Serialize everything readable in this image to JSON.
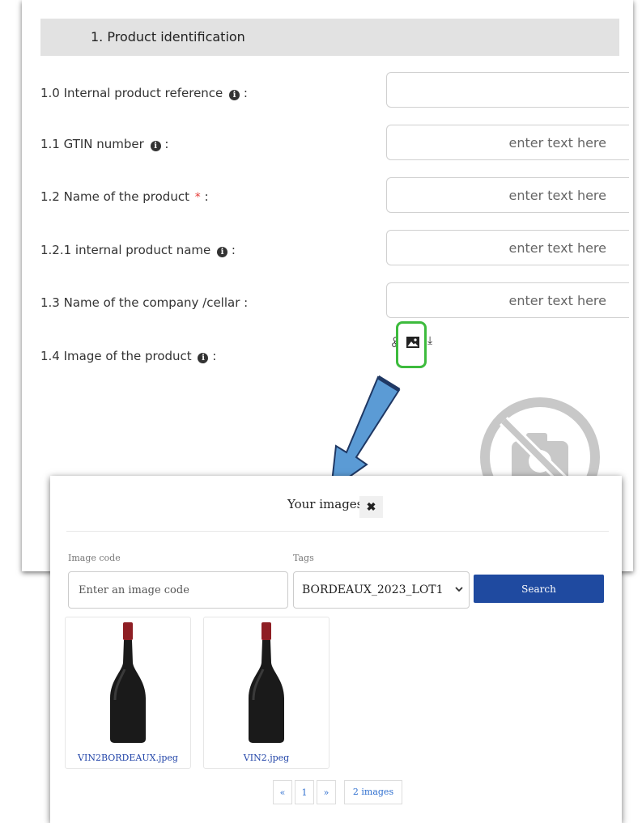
{
  "form": {
    "section_title": "1.  Product identification",
    "fields": [
      {
        "label": "1.0 Internal product reference",
        "placeholder": ""
      },
      {
        "label": "1.1 GTIN number",
        "placeholder": "enter text here"
      },
      {
        "label": "1.2 Name of the product",
        "placeholder": "enter text here"
      },
      {
        "label": "1.2.1 internal product name",
        "placeholder": "enter text here"
      },
      {
        "label": "1.3 Name of the company /cellar",
        "placeholder": "enter text here"
      },
      {
        "label": "1.4 Image of the product"
      }
    ],
    "colon": ":",
    "info_glyph": "i",
    "required_mark": "*"
  },
  "modal": {
    "title": "Your images",
    "close_glyph": "✖",
    "image_code_label": "Image code",
    "image_code_placeholder": "Enter an image code",
    "tags_label": "Tags",
    "tags_value": "BORDEAUX_2023_LOT1",
    "search_label": "Search",
    "images": [
      {
        "caption": "VIN2BORDEAUX.jpeg"
      },
      {
        "caption": "VIN2.jpeg"
      }
    ],
    "pagination": {
      "prev": "«",
      "page": "1",
      "next": "»",
      "count": "2 images"
    }
  },
  "colors": {
    "accent_green": "#3dbb3d",
    "arrow_blue": "#5b9bd5",
    "search_button": "#1f4aa0",
    "link_blue": "#2144a8"
  }
}
